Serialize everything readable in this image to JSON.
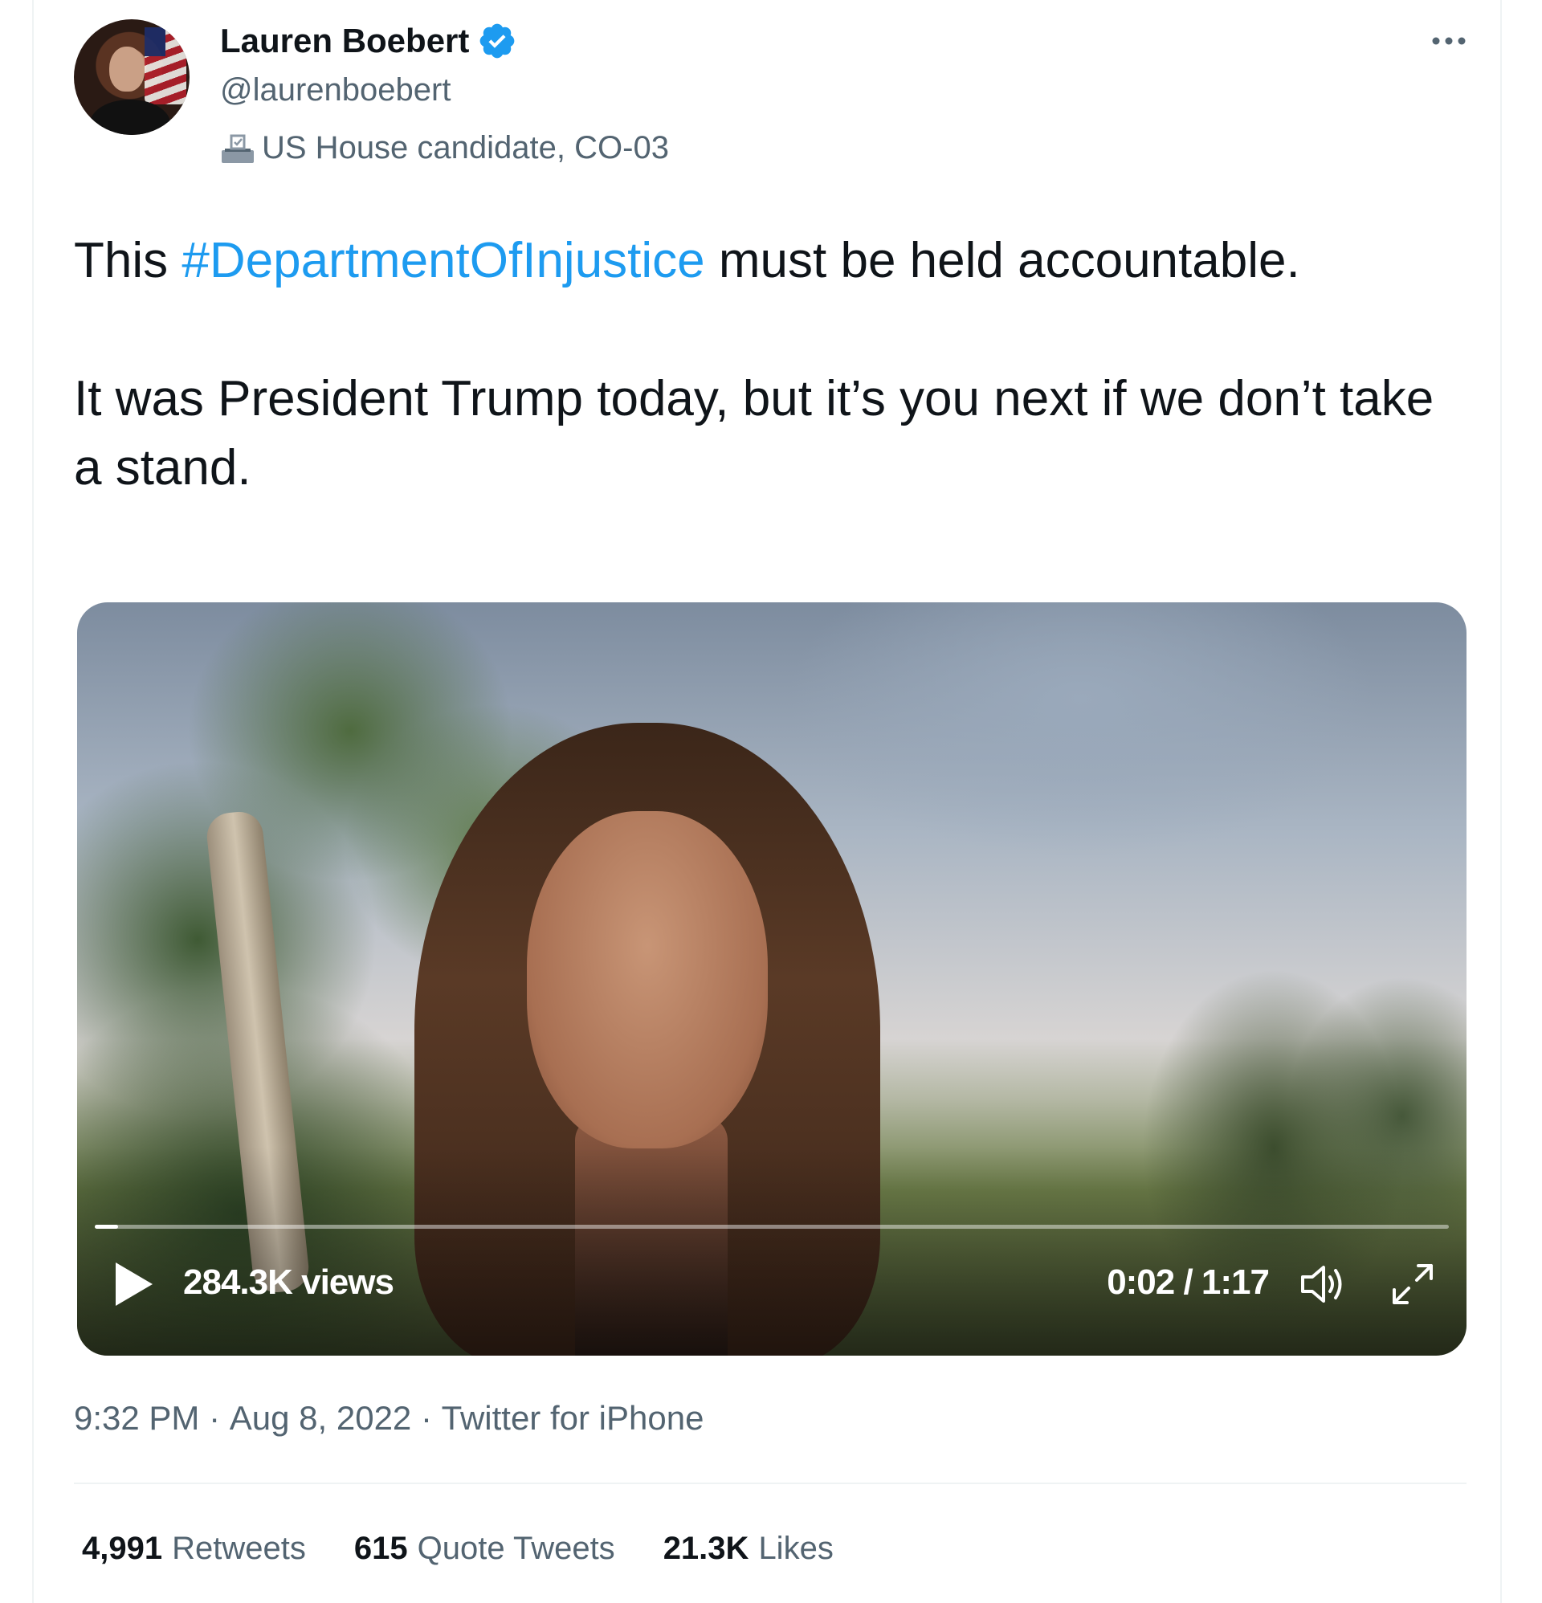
{
  "tweet": {
    "author_name": "Lauren Boebert",
    "handle": "@laurenboebert",
    "label": "US House candidate, CO-03",
    "text_before": "This ",
    "hashtag": "#DepartmentOfInjustice",
    "text_after": " must be held accountable.\n\nIt was President Trump today, but it’s you next if we don’t take a stand.",
    "time": "9:32 PM",
    "separator": " · ",
    "date": "Aug 8, 2022",
    "source": "Twitter for iPhone"
  },
  "video": {
    "views": "284.3K views",
    "timecode": "0:02 / 1:17",
    "progress_fraction": 0.017
  },
  "stats": [
    {
      "num": "4,991",
      "label": "Retweets"
    },
    {
      "num": "615",
      "label": "Quote Tweets"
    },
    {
      "num": "21.3K",
      "label": "Likes"
    }
  ],
  "colors": {
    "accent": "#1d9bf0",
    "text": "#0f1419",
    "muted": "#536471",
    "border": "#eff3f4"
  },
  "icons": {
    "verified": "verified-badge-icon",
    "label": "ballot-box-icon",
    "more": "more-dots-icon",
    "play": "play-icon",
    "volume": "volume-icon",
    "fullscreen": "fullscreen-icon"
  }
}
